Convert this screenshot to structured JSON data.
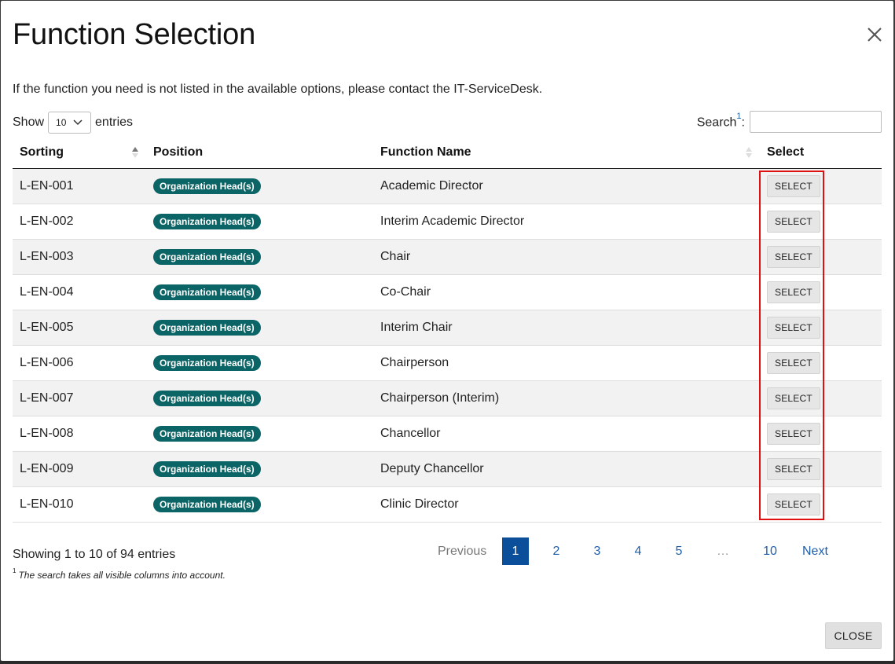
{
  "modal": {
    "title": "Function Selection",
    "info_text": "If the function you need is not listed in the available options, please contact the IT-ServiceDesk."
  },
  "length": {
    "show_label": "Show",
    "value": "10",
    "entries_label": "entries"
  },
  "search": {
    "label": "Search",
    "footnote_marker": "1",
    "colon": ":",
    "value": ""
  },
  "table": {
    "headers": [
      "Sorting",
      "Position",
      "Function Name",
      "Select"
    ],
    "rows": [
      {
        "sorting": "L-EN-001",
        "position": "Organization Head(s)",
        "function_name": "Academic Director",
        "select": "SELECT"
      },
      {
        "sorting": "L-EN-002",
        "position": "Organization Head(s)",
        "function_name": "Interim Academic Director",
        "select": "SELECT"
      },
      {
        "sorting": "L-EN-003",
        "position": "Organization Head(s)",
        "function_name": "Chair",
        "select": "SELECT"
      },
      {
        "sorting": "L-EN-004",
        "position": "Organization Head(s)",
        "function_name": "Co-Chair",
        "select": "SELECT"
      },
      {
        "sorting": "L-EN-005",
        "position": "Organization Head(s)",
        "function_name": "Interim Chair",
        "select": "SELECT"
      },
      {
        "sorting": "L-EN-006",
        "position": "Organization Head(s)",
        "function_name": "Chairperson",
        "select": "SELECT"
      },
      {
        "sorting": "L-EN-007",
        "position": "Organization Head(s)",
        "function_name": "Chairperson (Interim)",
        "select": "SELECT"
      },
      {
        "sorting": "L-EN-008",
        "position": "Organization Head(s)",
        "function_name": "Chancellor",
        "select": "SELECT"
      },
      {
        "sorting": "L-EN-009",
        "position": "Organization Head(s)",
        "function_name": "Deputy Chancellor",
        "select": "SELECT"
      },
      {
        "sorting": "L-EN-010",
        "position": "Organization Head(s)",
        "function_name": "Clinic Director",
        "select": "SELECT"
      }
    ]
  },
  "info": {
    "showing": "Showing 1 to 10 of 94 entries",
    "footnote_marker": "1",
    "footnote": "The search takes all visible columns into account."
  },
  "pagination": {
    "previous": "Previous",
    "pages": [
      "1",
      "2",
      "3",
      "4",
      "5"
    ],
    "current": "1",
    "ellipsis": "…",
    "last": "10",
    "next": "Next"
  },
  "footer": {
    "close_label": "CLOSE"
  },
  "colors": {
    "badge": "#0b6466",
    "pager_current": "#0b4f9a",
    "link": "#1e5fa8",
    "highlight": "#e01010"
  },
  "icons": {
    "close": "close-icon",
    "chevron": "chevron-down-icon",
    "sort": "sort-icon"
  }
}
